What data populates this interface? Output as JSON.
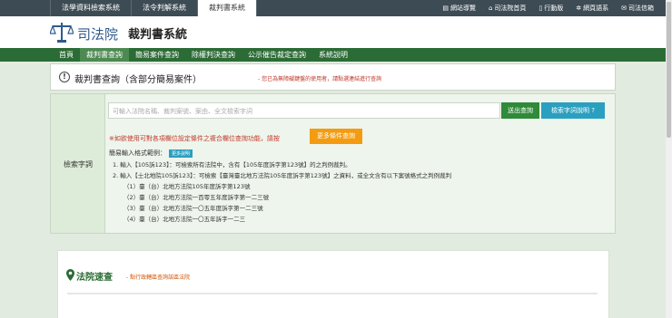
{
  "top_tabs": [
    "法學資料檢索系統",
    "法令判解系統",
    "裁判書系統"
  ],
  "top_links": [
    {
      "icon": "sitemap-icon",
      "label": "網站導覽"
    },
    {
      "icon": "home-icon",
      "label": "司法院首頁"
    },
    {
      "icon": "mobile-icon",
      "label": "行動版"
    },
    {
      "icon": "gear-icon",
      "label": "網頁語系"
    },
    {
      "icon": "mail-icon",
      "label": "司法信箱"
    }
  ],
  "header": {
    "org": "司法院",
    "system": "裁判書系統"
  },
  "nav": [
    "首頁",
    "裁判書查詢",
    "簡易案件查詢",
    "除權判決查詢",
    "公示催告裁定查詢",
    "系統說明"
  ],
  "section": {
    "title": "裁判書查詢（含部分簡易案件）",
    "note": "- 您已為無障礙鍵盤的使用者，請點選連結進行查詢"
  },
  "search": {
    "label": "檢索字詞",
    "placeholder": "可輸入法院名稱、裁判案號、案由、全文檢索字詞",
    "submit_label": "送出查詢",
    "help_label": "檢索字詞說明 ?",
    "advanced_note": "※如欲使用可對各項欄位設定條件之複合欄位查詢功能，請按",
    "more_label": "更多條件查詢",
    "format_label": "簡易輸入格式範例：",
    "format_badge": "更多說明",
    "examples": [
      "1. 輸入【105訴123】：可檢索所有法院中，含有【105年度訴字第123號】的之判例裁判。",
      "2. 輸入【士北地院105訴123】：可檢索【臺灣臺北地方法院105年度訴字第123號】之資料，或全文含有以下案號格式之判例裁判",
      "（1）臺（台）北地方法院105年度訴字第123號",
      "（2）臺（台）北地方法院一百零五年度訴字第一二三號",
      "（3）臺（台）北地方法院一〇五年度訴字第一二三號",
      "（4）臺（台）北地方法院一〇五年訴字一二三"
    ]
  },
  "court_panel": {
    "title": "法院速查",
    "subtitle": "- 點行政轄區查詢該區法院"
  },
  "colors": {
    "topbar": "#3d4b54",
    "nav": "#2b6b35",
    "submit": "#2f8a3a",
    "help": "#2a9fbf",
    "more": "#f39c12"
  }
}
